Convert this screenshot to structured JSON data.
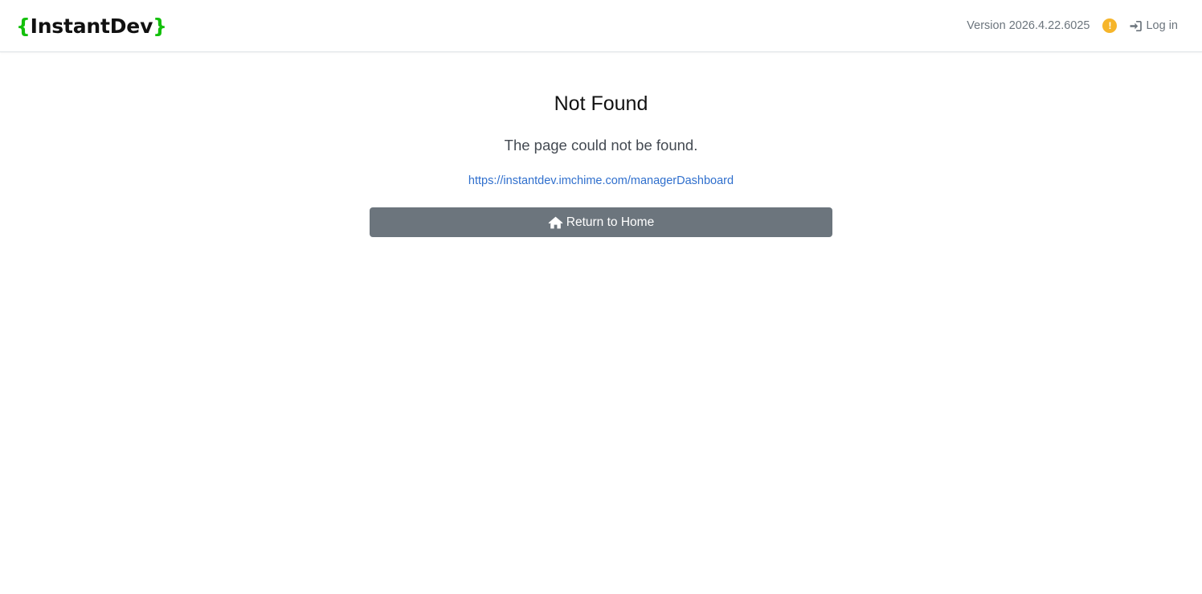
{
  "header": {
    "brand_open": "{",
    "brand_name": "InstantDev",
    "brand_close": "}",
    "version_text": "Version 2026.4.22.6025",
    "warning_icon": "!",
    "login_label": "Log in"
  },
  "main": {
    "title": "Not Found",
    "message": "The page could not be found.",
    "requested_url": "https://instantdev.imchime.com/managerDashboard",
    "home_button_label": "Return to Home"
  },
  "colors": {
    "brand_brace": "#13c00b",
    "warning": "#f6b52a",
    "link": "#2f6fcd",
    "button": "#6c757d"
  },
  "icons": [
    "exclamation-circle-icon",
    "sign-in-icon",
    "home-icon"
  ]
}
